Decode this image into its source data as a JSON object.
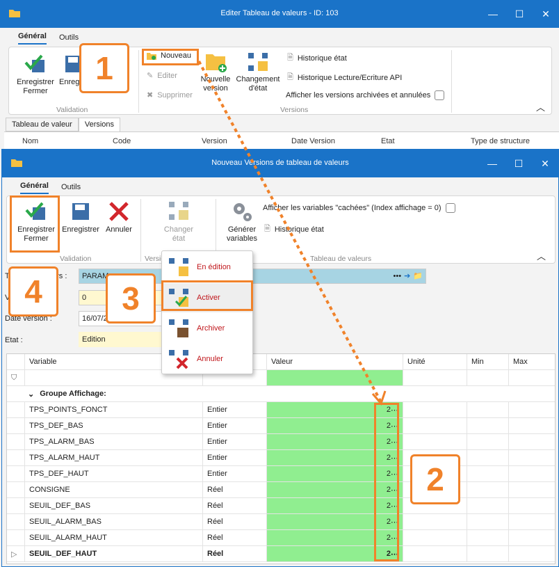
{
  "window1": {
    "title": "Editer Tableau de valeurs - ID: 103",
    "tabs": [
      "Général",
      "Outils"
    ],
    "ribbon": {
      "save_close": "Enregistrer\nFermer",
      "save": "Enregistrer",
      "nouveau": "Nouveau",
      "editer": "Editer",
      "supprimer": "Supprimer",
      "nouvelle_version": "Nouvelle\nversion",
      "changement_etat": "Changement\nd'état",
      "hist_etat": "Historique état",
      "hist_api": "Historique Lecture/Ecriture API",
      "afficher_versions": "Afficher les versions archivées et annulées",
      "grp_validation": "Validation",
      "grp_versions": "Versions"
    },
    "subtabs": [
      "Tableau de valeur",
      "Versions"
    ],
    "columns": [
      "Nom",
      "Code",
      "Version",
      "Date Version",
      "Etat",
      "Type de structure"
    ]
  },
  "window2": {
    "title": "Nouveau Versions de tableau de valeurs",
    "tabs": [
      "Général",
      "Outils"
    ],
    "ribbon": {
      "save_close": "Enregistrer\nFermer",
      "save": "Enregistrer",
      "annuler": "Annuler",
      "changer_etat": "Changer\nétat",
      "generer": "Générer\nvariables",
      "afficher_cachees": "Afficher les variables \"cachées\" (Index affichage = 0)",
      "hist_etat": "Historique état",
      "grp_validation": "Validation",
      "grp_version": "Versio",
      "grp_tableau": "Tableau de valeurs"
    },
    "form": {
      "label_tableau": "T",
      "label_tableau2": "urs :",
      "tableau_value": "PARAM",
      "label_version": "V",
      "version_value": "0",
      "label_date": "Date version :",
      "date_value": "16/07/2",
      "label_etat": "Etat :",
      "etat_value": "Edition"
    },
    "grid_cols": [
      "Variable",
      "",
      "Valeur",
      "Unité",
      "Min",
      "Max"
    ],
    "group": "Groupe Affichage:",
    "rows": [
      {
        "var": "TPS_POINTS_FONCT",
        "type": "Entier",
        "val": "2"
      },
      {
        "var": "TPS_DEF_BAS",
        "type": "Entier",
        "val": "2"
      },
      {
        "var": "TPS_ALARM_BAS",
        "type": "Entier",
        "val": "2"
      },
      {
        "var": "TPS_ALARM_HAUT",
        "type": "Entier",
        "val": "2"
      },
      {
        "var": "TPS_DEF_HAUT",
        "type": "Entier",
        "val": "2"
      },
      {
        "var": "CONSIGNE",
        "type": "Réel",
        "val": "2"
      },
      {
        "var": "SEUIL_DEF_BAS",
        "type": "Réel",
        "val": "2"
      },
      {
        "var": "SEUIL_ALARM_BAS",
        "type": "Réel",
        "val": "2"
      },
      {
        "var": "SEUIL_ALARM_HAUT",
        "type": "Réel",
        "val": "2"
      },
      {
        "var": "SEUIL_DEF_HAUT",
        "type": "Réel",
        "val": "2"
      }
    ]
  },
  "menu": {
    "items": [
      "En édition",
      "Activer",
      "Archiver",
      "Annuler"
    ]
  },
  "callouts": [
    "1",
    "2",
    "3",
    "4"
  ],
  "colors": {
    "accent": "#1a73c8",
    "orange": "#f0822a",
    "green": "#90ee90",
    "red": "#c0161b"
  }
}
